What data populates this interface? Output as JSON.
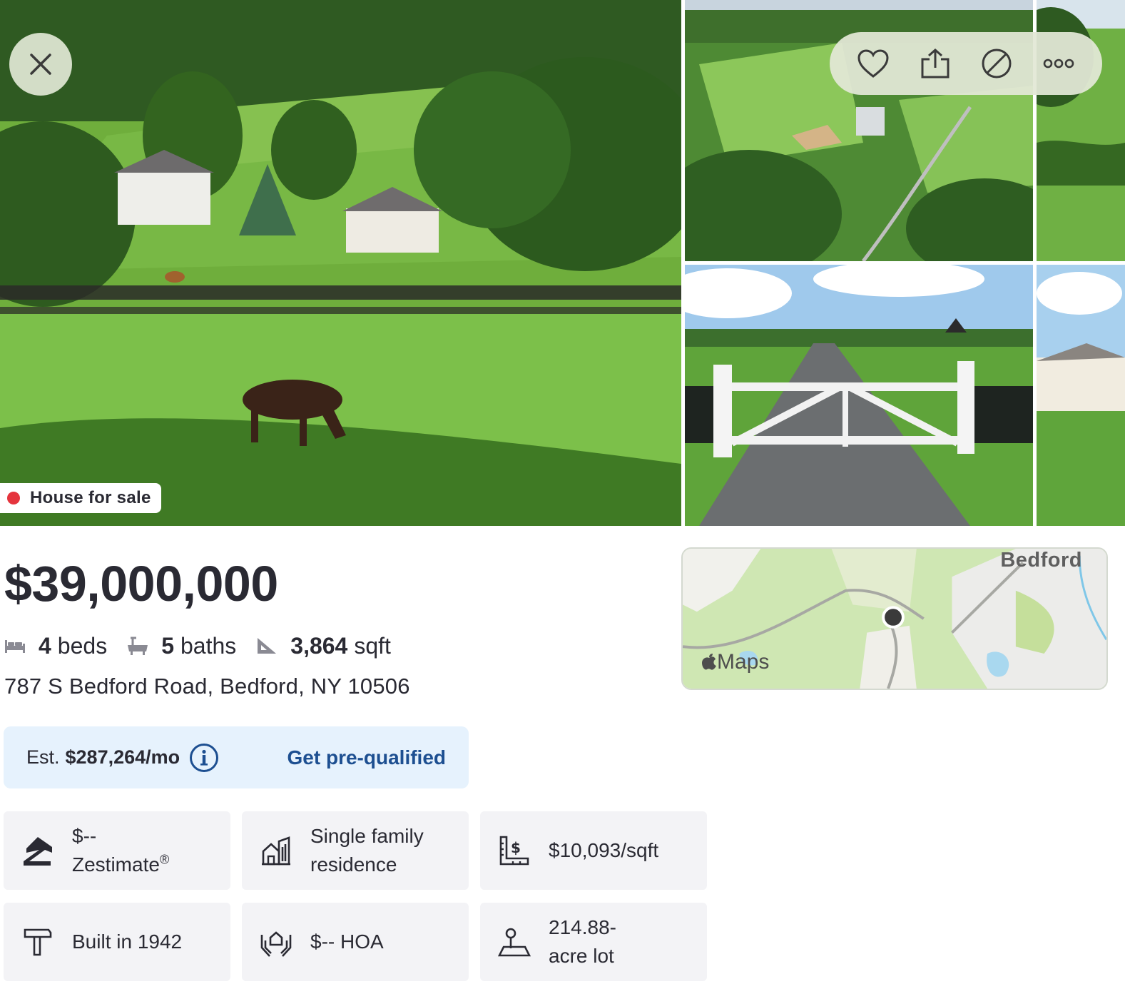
{
  "gallery": {
    "photos": [
      {
        "name": "photo-main"
      },
      {
        "name": "photo-aerial"
      },
      {
        "name": "photo-gate"
      }
    ],
    "listing_status": "House for sale",
    "status_color": "#e5343d",
    "actions": [
      "close-icon",
      "heart-icon",
      "share-icon",
      "hide-icon",
      "more-icon"
    ]
  },
  "summary": {
    "price": "$39,000,000",
    "beds_value": "4",
    "beds_label": "beds",
    "baths_value": "5",
    "baths_label": "baths",
    "sqft_value": "3,864",
    "sqft_label": "sqft",
    "address": "787 S Bedford Road, Bedford, NY 10506"
  },
  "mortgage": {
    "est_label": "Est.",
    "est_value": "$287,264/mo",
    "cta": "Get pre-qualified",
    "accent": "#1d4f91"
  },
  "map": {
    "town": "Bedford",
    "brand": "Maps"
  },
  "features": {
    "zestimate_value": "$--",
    "zestimate_label": "Zestimate",
    "zestimate_mark": "®",
    "home_type_line1": "Single family",
    "home_type_line2": "residence",
    "price_per_sqft": "$10,093/sqft",
    "year_built": "Built in 1942",
    "hoa": "$-- HOA",
    "lot_line1": "214.88-",
    "lot_line2": "acre lot"
  }
}
